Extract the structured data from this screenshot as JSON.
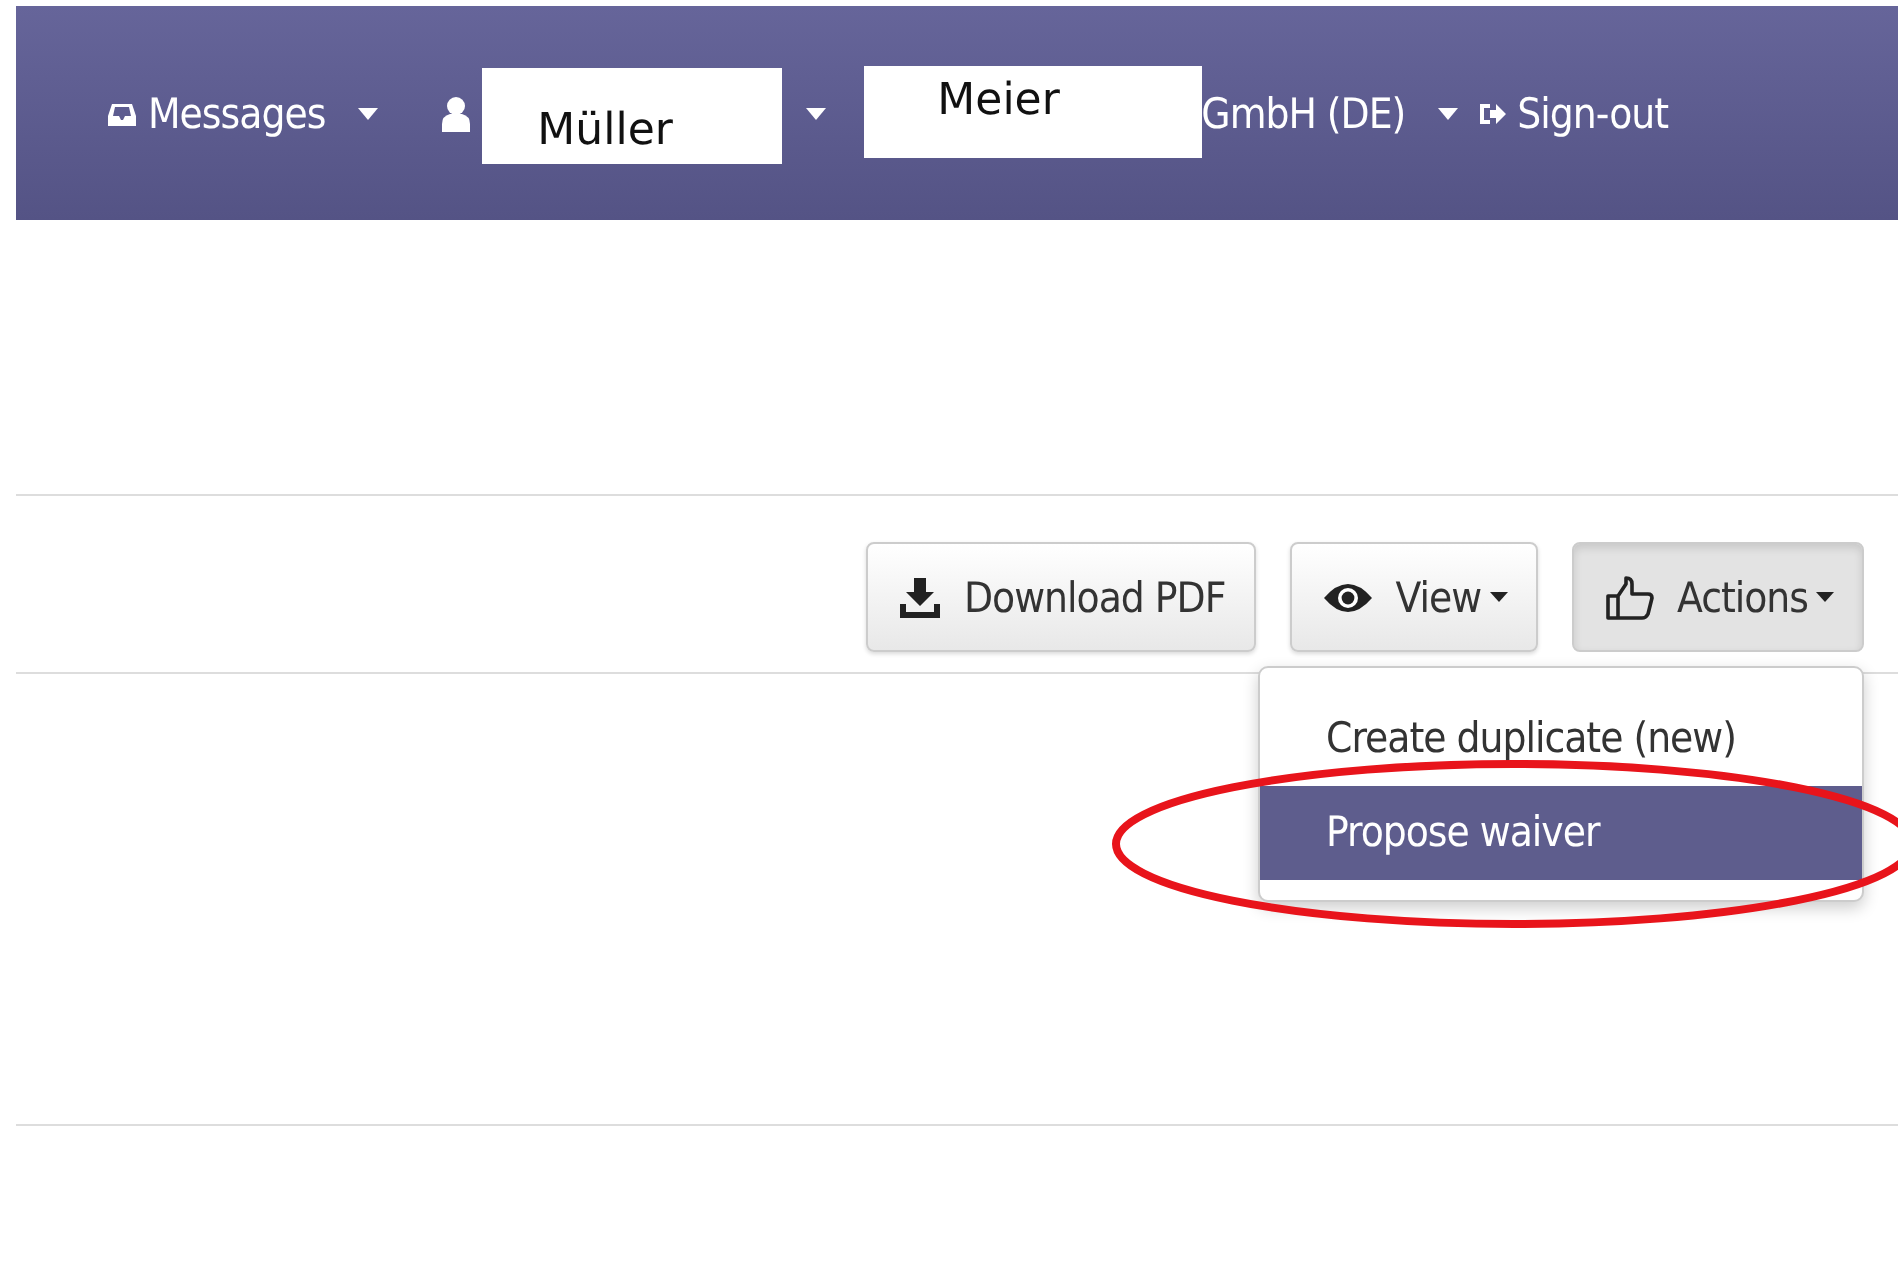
{
  "navbar": {
    "messages": {
      "label": "Messages"
    },
    "user": {
      "name": "Müller"
    },
    "company": {
      "name_part": "Meier",
      "suffix": "GmbH (DE)"
    },
    "sign_out": {
      "label": "Sign-out"
    }
  },
  "toolbar": {
    "buttons": [
      {
        "label": "Download PDF",
        "kind": "download",
        "dropdown": false,
        "expanded": false
      },
      {
        "label": "View",
        "kind": "view",
        "dropdown": true,
        "expanded": false
      },
      {
        "label": "Actions",
        "kind": "actions",
        "dropdown": true,
        "expanded": true
      }
    ]
  },
  "actions_menu": {
    "items": [
      {
        "label": "Create duplicate (new)",
        "selected": false
      },
      {
        "label": "Propose waiver",
        "selected": true
      }
    ]
  }
}
